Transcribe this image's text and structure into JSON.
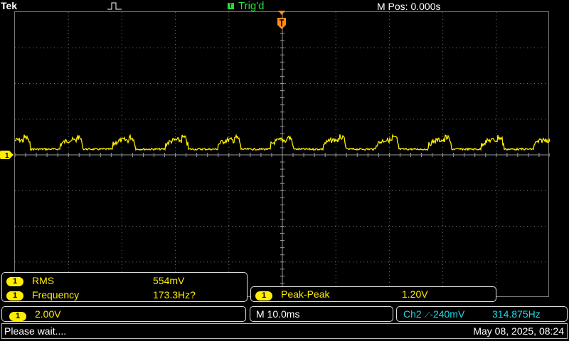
{
  "header": {
    "brand": "Tek",
    "trigger_status": "Trig'd",
    "trigger_icon_letter": "T",
    "m_pos": "M Pos: 0.000s"
  },
  "markers": {
    "channel1": "1"
  },
  "measurements": {
    "rows": [
      {
        "channel": "1",
        "label": "RMS",
        "value": "554mV"
      },
      {
        "channel": "1",
        "label": "Frequency",
        "value": "173.3Hz?"
      }
    ],
    "peak_peak": {
      "channel": "1",
      "label": "Peak-Peak",
      "value": "1.20V"
    }
  },
  "settings": {
    "ch1_channel": "1",
    "ch1_scale": "2.00V",
    "timebase": "M 10.0ms",
    "trigger_source": "Ch2",
    "trigger_slope_symbol": "⟋",
    "trigger_level": "-240mV",
    "trigger_frequency": "314.875Hz"
  },
  "status": {
    "message": "Please wait....",
    "datetime": "May 08, 2025, 08:24"
  },
  "colors": {
    "ch1": "#ffee00",
    "trigger": "#ff8c1a",
    "trig_status": "#22e03a",
    "ch2": "#20d8e8"
  }
}
